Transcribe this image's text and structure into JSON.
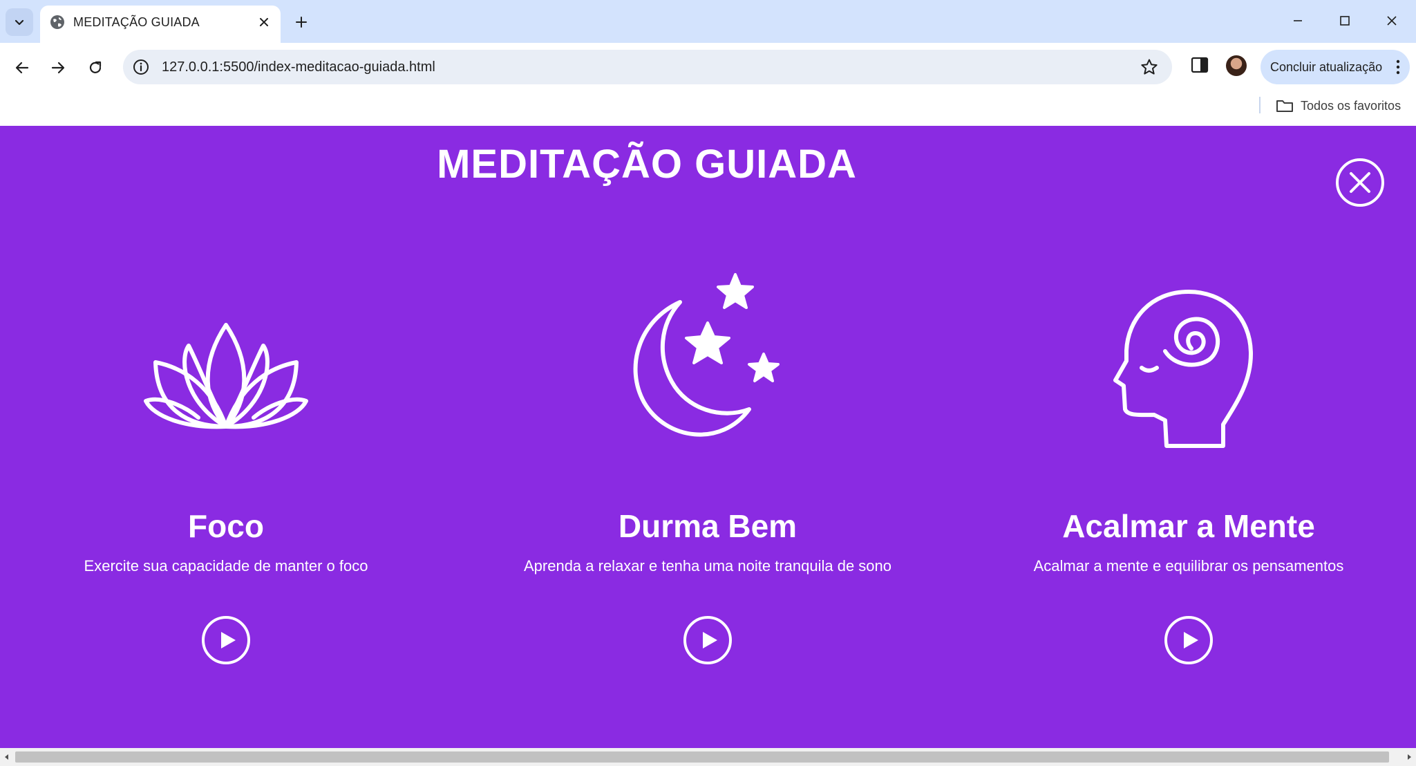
{
  "browser": {
    "tab_title": "MEDITAÇÃO GUIADA",
    "url": "127.0.0.1:5500/index-meditacao-guiada.html",
    "update_button_label": "Concluir atualização",
    "bookmarks_folder_label": "Todos os favoritos"
  },
  "page": {
    "title": "MEDITAÇÃO GUIADA",
    "background_color": "#8a2be2",
    "cards": [
      {
        "icon": "lotus-icon",
        "title": "Foco",
        "description": "Exercite sua capacidade de manter o foco"
      },
      {
        "icon": "moon-stars-icon",
        "title": "Durma Bem",
        "description": "Aprenda a relaxar e tenha uma noite tranquila de sono"
      },
      {
        "icon": "spiral-head-icon",
        "title": "Acalmar a Mente",
        "description": "Acalmar a mente e equilibrar os pensamentos"
      }
    ]
  }
}
